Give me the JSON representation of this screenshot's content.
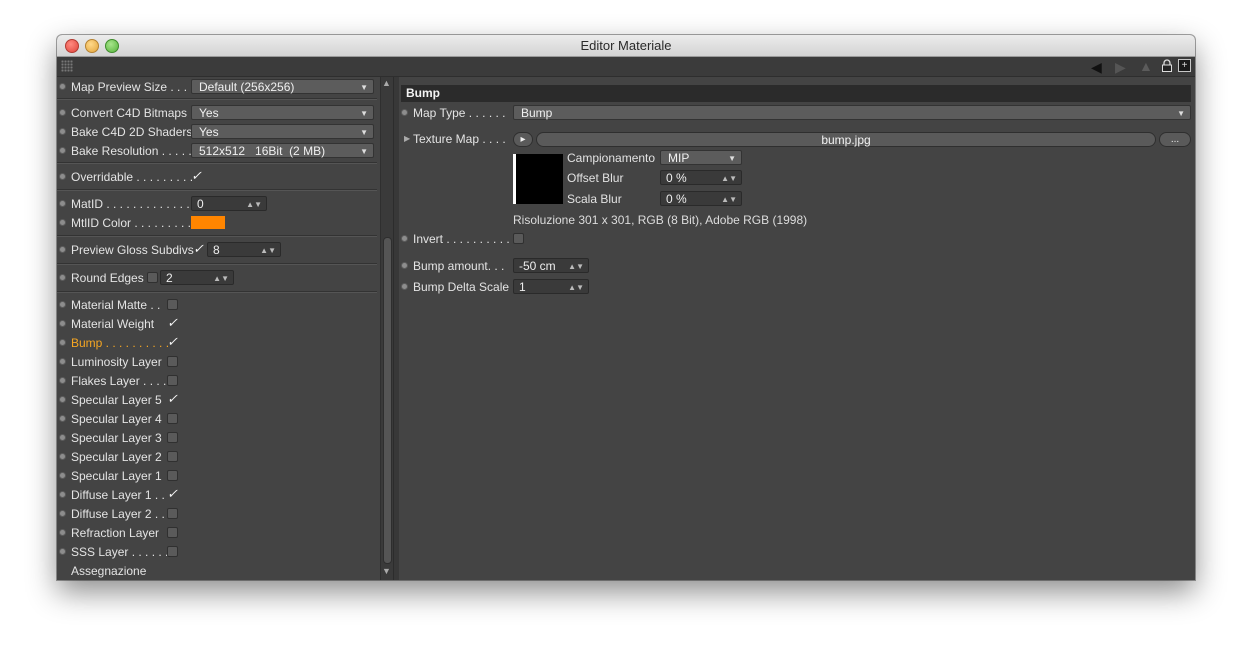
{
  "window": {
    "title": "Editor Materiale"
  },
  "left": {
    "map_preview_size": {
      "label": "Map Preview Size . . . .",
      "value": "Default (256x256)"
    },
    "convert_c4d_bitmaps": {
      "label": "Convert C4D Bitmaps",
      "value": "Yes"
    },
    "bake_c4d_2d_shaders": {
      "label": "Bake C4D 2D Shaders",
      "value": "Yes"
    },
    "bake_resolution": {
      "label": "Bake Resolution . . . . .",
      "value": "512x512   16Bit  (2 MB)"
    },
    "overridable": {
      "label": "Overridable . . . . . . . . .",
      "checked": true
    },
    "matid": {
      "label": "MatID . . . . . . . . . . . . . .",
      "value": "0"
    },
    "mtlid_color": {
      "label": "MtlID Color . . . . . . . . .",
      "color": "#ff8500"
    },
    "preview_gloss_subdivs": {
      "label": "Preview Gloss Subdivs",
      "checked": true,
      "value": "8"
    },
    "round_edges": {
      "label": "Round Edges",
      "checked": false,
      "value": "2"
    },
    "layers": [
      {
        "label": "Material Matte . .",
        "checked": false,
        "active": false
      },
      {
        "label": "Material Weight",
        "checked": true,
        "active": false
      },
      {
        "label": "Bump . . . . . . . . . .",
        "checked": true,
        "active": true
      },
      {
        "label": "Luminosity Layer",
        "checked": false,
        "active": false
      },
      {
        "label": "Flakes Layer . . . .",
        "checked": false,
        "active": false
      },
      {
        "label": "Specular Layer 5",
        "checked": true,
        "active": false
      },
      {
        "label": "Specular Layer 4",
        "checked": false,
        "active": false
      },
      {
        "label": "Specular Layer 3",
        "checked": false,
        "active": false
      },
      {
        "label": "Specular Layer 2",
        "checked": false,
        "active": false
      },
      {
        "label": "Specular Layer 1",
        "checked": false,
        "active": false
      },
      {
        "label": "Diffuse Layer 1 . .",
        "checked": true,
        "active": false
      },
      {
        "label": "Diffuse Layer 2 . .",
        "checked": false,
        "active": false
      },
      {
        "label": "Refraction Layer",
        "checked": false,
        "active": false
      },
      {
        "label": "SSS Layer . . . . . . .",
        "checked": false,
        "active": false
      }
    ],
    "assegnazione": "Assegnazione"
  },
  "right": {
    "section_title": "Bump",
    "map_type": {
      "label": "Map Type . . . . . .",
      "value": "Bump"
    },
    "texture_map": {
      "label": "Texture Map . . . .",
      "file": "bump.jpg",
      "more": "..."
    },
    "campionamento": {
      "label": "Campionamento",
      "value": "MIP"
    },
    "offset_blur": {
      "label": "Offset Blur",
      "value": "0 %"
    },
    "scala_blur": {
      "label": "Scala Blur",
      "value": "0 %"
    },
    "resolution_info": "Risoluzione 301 x 301, RGB (8 Bit), Adobe RGB (1998)",
    "invert": {
      "label": "Invert . . . . . . . . . .",
      "checked": false
    },
    "bump_amount": {
      "label": "Bump amount. . .",
      "value": "-50 cm"
    },
    "bump_delta_scale": {
      "label": "Bump Delta Scale",
      "value": "1"
    }
  }
}
